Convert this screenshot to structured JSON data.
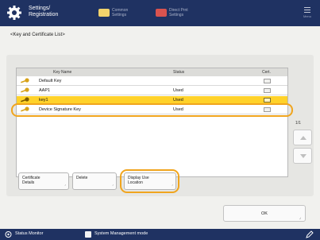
{
  "header": {
    "title_line1": "Settings/",
    "title_line2": "Registration",
    "btn1_line1": "Common",
    "btn1_line2": "Settings",
    "btn2_line1": "Direct Prnt",
    "btn2_line2": "Settings",
    "menu_label": "Menu"
  },
  "breadcrumb": "<Key and Certificate List>",
  "table": {
    "headers": {
      "name": "Key Name",
      "status": "Status",
      "cert": "Cert."
    },
    "rows": [
      {
        "name": "Default Key",
        "status": ""
      },
      {
        "name": "AAP1",
        "status": "Used"
      },
      {
        "name": "key1",
        "status": "Used",
        "selected": true
      },
      {
        "name": "Device Signature Key",
        "status": "Used"
      }
    ]
  },
  "pager": "1/1",
  "actions": {
    "cert_details_line1": "Certificate",
    "cert_details_line2": "Details",
    "delete": "Delete",
    "display_use_line1": "Display Use",
    "display_use_line2": "Location"
  },
  "ok_label": "OK",
  "footer": {
    "status_monitor": "Status Monitor",
    "system_mode": "System Management mode"
  },
  "colors": {
    "selected": "#ffd22a",
    "highlight": "#f0a51e",
    "bar": "#1f3262"
  }
}
